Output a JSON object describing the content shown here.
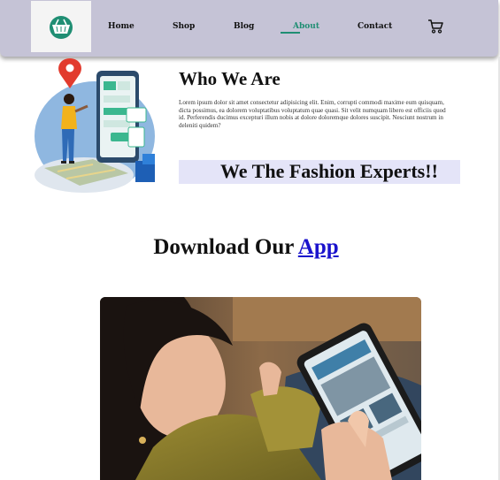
{
  "nav": {
    "links": [
      "Home",
      "Shop",
      "Blog",
      "About",
      "Contact"
    ],
    "active": "About"
  },
  "about": {
    "title": "Who We Are",
    "body": "Lorem ipsum dolor sit amet consectetur adipisicing elit. Enim, corrupti commodi maxime eum quisquam, dicta possimus, ea dolorem voluptatibus voluptatum quae quasi. Sit velit numquam libero est officiis quod id. Perferendis ducimus excepturi illum nobis at dolore doloremque dolores suscipit. Nesciunt nostrum in deleniti quidem?",
    "tagline": "We The Fashion Experts!!"
  },
  "download": {
    "text": "Download Our",
    "link": "App"
  },
  "colors": {
    "navbar": "#c5c3d6",
    "accent": "#1f8e73",
    "link": "#1a12cc",
    "tagline_band": "#e4e4f8"
  },
  "icons": {
    "logo": "shopping-basket-icon",
    "cart": "cart-icon"
  }
}
